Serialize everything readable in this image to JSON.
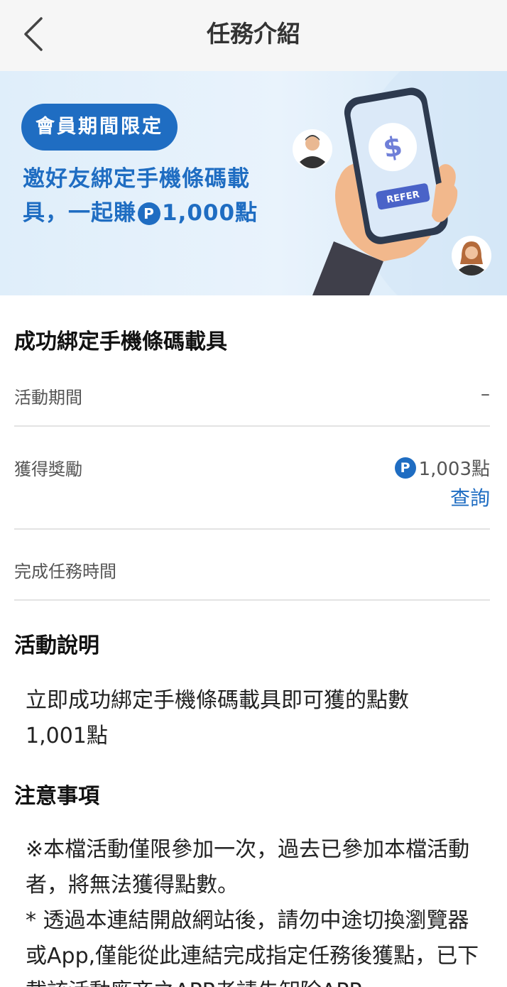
{
  "header": {
    "title": "任務介紹",
    "back_icon": "chevron-left-icon"
  },
  "banner": {
    "badge": "會員期間限定",
    "headline_line1": "邀好友綁定手機條碼載",
    "headline_line2_prefix": "具，一起賺",
    "coin_symbol": "P",
    "headline_line2_suffix": "1,000點",
    "refer_label": "REFER",
    "dollar_symbol": "$",
    "accent_color": "#1f6dc2"
  },
  "task": {
    "title": "成功綁定手機條碼載具",
    "period_label": "活動期間",
    "period_value": "–",
    "reward_label": "獲得獎勵",
    "reward_coin": "P",
    "reward_value": "1,003點",
    "query_link": "查詢",
    "complete_time_label": "完成任務時間"
  },
  "description": {
    "title": "活動說明",
    "text": "立即成功綁定手機條碼載具即可獲的點數1,001點"
  },
  "notes": {
    "title": "注意事項",
    "text": "※本檔活動僅限參加一次，過去已參加本檔活動者，將無法獲得點數。\n* 透過本連結開啟網站後，請勿中途切換瀏覽器或App,僅能從此連結完成指定任務後獲點，已下載該活動廠商之APP者請先卸除APP"
  }
}
